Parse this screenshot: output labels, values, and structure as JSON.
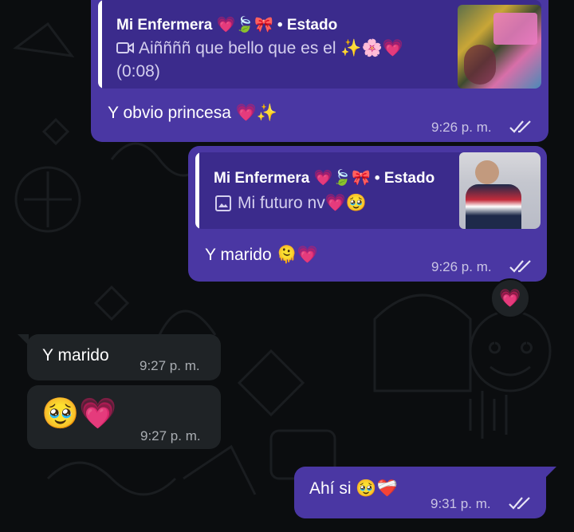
{
  "messages": [
    {
      "reply": {
        "title": "Mi Enfermera 💗🍃🎀 • Estado",
        "icon": "video-icon",
        "text": "Aiññññ que bello que es el ✨🌸💗",
        "extra": "(0:08)"
      },
      "text": "Y obvio princesa 💗✨",
      "time": "9:26 p. m."
    },
    {
      "reply": {
        "title": "Mi Enfermera 💗🍃🎀 • Estado",
        "icon": "image-icon",
        "text": "Mi futuro nv💗🥹"
      },
      "text": "Y marido 🫠💗",
      "time": "9:26 p. m.",
      "reaction": "💗"
    },
    {
      "text": "Y marido",
      "time": "9:27 p. m."
    },
    {
      "text": "🥹💗",
      "time": "9:27 p. m."
    },
    {
      "text": "Ahí si 🥹❤️‍🩹",
      "time": "9:31 p. m."
    }
  ],
  "colors": {
    "outgoing": "#4a37a3",
    "incoming": "#1f2326",
    "background": "#0b0d0f",
    "read_ticks": "#e6e3f5"
  }
}
